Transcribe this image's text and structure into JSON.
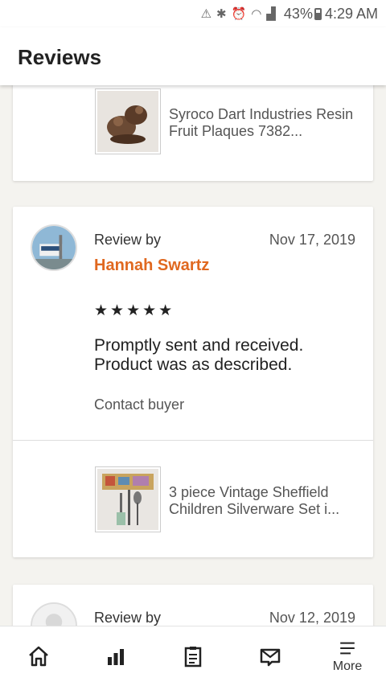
{
  "status_bar": {
    "icons": [
      "alert-triangle-icon",
      "bluetooth-icon",
      "alarm-icon",
      "wifi-icon",
      "signal-icon"
    ],
    "battery": "43%",
    "time": "4:29 AM"
  },
  "header": {
    "title": "Reviews"
  },
  "reviews": [
    {
      "product_title": "Syroco Dart Industries Resin Fruit Plaques 7382..."
    },
    {
      "review_by_label": "Review by",
      "reviewer": "Hannah Swartz",
      "date": "Nov 17, 2019",
      "rating": 5,
      "stars": "★★★★★",
      "text": "Promptly sent and received. Product was as described.",
      "contact_label": "Contact buyer",
      "product_title": "3 piece Vintage Sheffield Children Silverware Set i..."
    },
    {
      "review_by_label": "Review by",
      "date": "Nov 12, 2019"
    }
  ],
  "bottom_nav": {
    "items": [
      {
        "icon": "home-icon"
      },
      {
        "icon": "stats-icon"
      },
      {
        "icon": "orders-icon"
      },
      {
        "icon": "messages-icon"
      },
      {
        "icon": "menu-icon",
        "label": "More"
      }
    ]
  },
  "colors": {
    "accent": "#e0681f",
    "background": "#f4f3ef"
  }
}
